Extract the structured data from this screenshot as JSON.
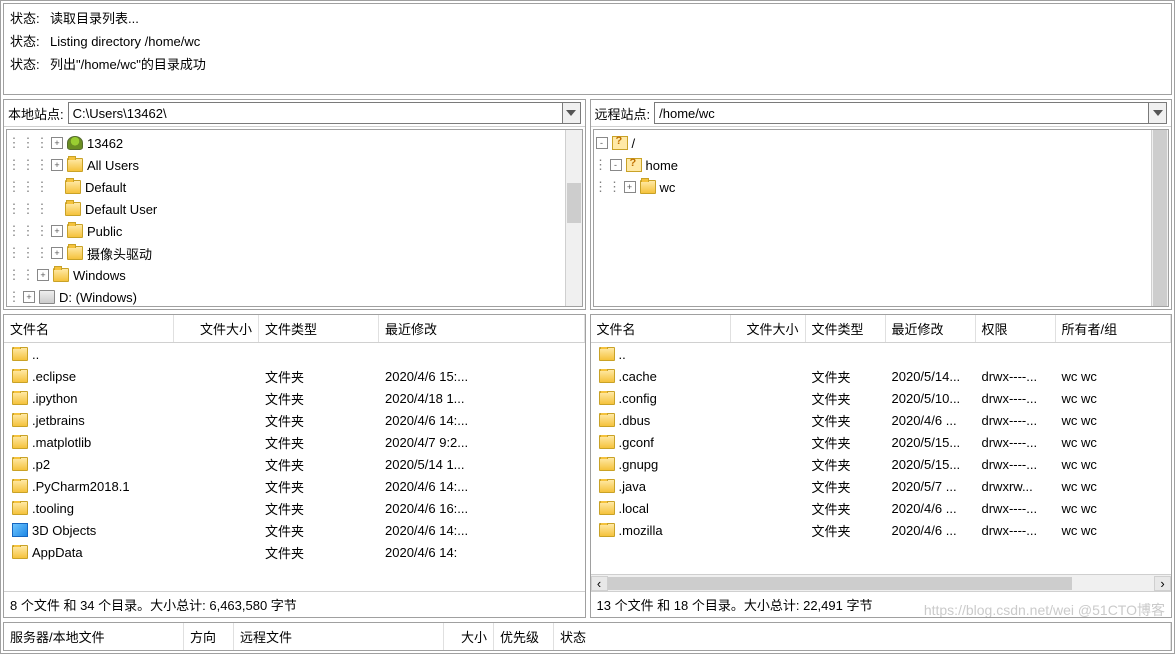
{
  "log": {
    "label": "状态:",
    "lines": [
      "读取目录列表...",
      "Listing directory /home/wc",
      "列出\"/home/wc\"的目录成功"
    ]
  },
  "local": {
    "site_label": "本地站点:",
    "path": "C:\\Users\\13462\\",
    "tree": [
      {
        "indent": 3,
        "exp": "+",
        "icon": "user",
        "label": "13462"
      },
      {
        "indent": 3,
        "exp": "+",
        "icon": "folder",
        "label": "All Users"
      },
      {
        "indent": 3,
        "exp": "",
        "icon": "folder",
        "label": "Default"
      },
      {
        "indent": 3,
        "exp": "",
        "icon": "folder",
        "label": "Default User"
      },
      {
        "indent": 3,
        "exp": "+",
        "icon": "folder",
        "label": "Public"
      },
      {
        "indent": 3,
        "exp": "+",
        "icon": "folder",
        "label": "摄像头驱动"
      },
      {
        "indent": 2,
        "exp": "+",
        "icon": "folder",
        "label": "Windows"
      },
      {
        "indent": 1,
        "exp": "+",
        "icon": "drive",
        "label": "D: (Windows)"
      }
    ],
    "columns": [
      "文件名",
      "文件大小",
      "文件类型",
      "最近修改"
    ],
    "files": [
      {
        "icon": "folder",
        "name": "..",
        "size": "",
        "type": "",
        "date": ""
      },
      {
        "icon": "folder",
        "name": ".eclipse",
        "size": "",
        "type": "文件夹",
        "date": "2020/4/6 15:..."
      },
      {
        "icon": "folder",
        "name": ".ipython",
        "size": "",
        "type": "文件夹",
        "date": "2020/4/18 1..."
      },
      {
        "icon": "folder",
        "name": ".jetbrains",
        "size": "",
        "type": "文件夹",
        "date": "2020/4/6 14:..."
      },
      {
        "icon": "folder",
        "name": ".matplotlib",
        "size": "",
        "type": "文件夹",
        "date": "2020/4/7 9:2..."
      },
      {
        "icon": "folder",
        "name": ".p2",
        "size": "",
        "type": "文件夹",
        "date": "2020/5/14 1..."
      },
      {
        "icon": "folder",
        "name": ".PyCharm2018.1",
        "size": "",
        "type": "文件夹",
        "date": "2020/4/6 14:..."
      },
      {
        "icon": "folder",
        "name": ".tooling",
        "size": "",
        "type": "文件夹",
        "date": "2020/4/6 16:..."
      },
      {
        "icon": "cube",
        "name": "3D Objects",
        "size": "",
        "type": "文件夹",
        "date": "2020/4/6 14:..."
      },
      {
        "icon": "folder",
        "name": "AppData",
        "size": "",
        "type": "文件夹",
        "date": "2020/4/6 14:"
      }
    ],
    "summary": "8 个文件 和 34 个目录。大小总计: 6,463,580 字节"
  },
  "remote": {
    "site_label": "远程站点:",
    "path": "/home/wc",
    "tree": [
      {
        "indent": 0,
        "exp": "-",
        "icon": "q",
        "label": "/"
      },
      {
        "indent": 1,
        "exp": "-",
        "icon": "q",
        "label": "home"
      },
      {
        "indent": 2,
        "exp": "+",
        "icon": "folder",
        "label": "wc"
      }
    ],
    "columns": [
      "文件名",
      "文件大小",
      "文件类型",
      "最近修改",
      "权限",
      "所有者/组"
    ],
    "files": [
      {
        "icon": "folder",
        "name": "..",
        "size": "",
        "type": "",
        "date": "",
        "perm": "",
        "own": ""
      },
      {
        "icon": "folder",
        "name": ".cache",
        "size": "",
        "type": "文件夹",
        "date": "2020/5/14...",
        "perm": "drwx----...",
        "own": "wc wc"
      },
      {
        "icon": "folder",
        "name": ".config",
        "size": "",
        "type": "文件夹",
        "date": "2020/5/10...",
        "perm": "drwx----...",
        "own": "wc wc"
      },
      {
        "icon": "folder",
        "name": ".dbus",
        "size": "",
        "type": "文件夹",
        "date": "2020/4/6 ...",
        "perm": "drwx----...",
        "own": "wc wc"
      },
      {
        "icon": "folder",
        "name": ".gconf",
        "size": "",
        "type": "文件夹",
        "date": "2020/5/15...",
        "perm": "drwx----...",
        "own": "wc wc"
      },
      {
        "icon": "folder",
        "name": ".gnupg",
        "size": "",
        "type": "文件夹",
        "date": "2020/5/15...",
        "perm": "drwx----...",
        "own": "wc wc"
      },
      {
        "icon": "folder",
        "name": ".java",
        "size": "",
        "type": "文件夹",
        "date": "2020/5/7 ...",
        "perm": "drwxrw...",
        "own": "wc wc"
      },
      {
        "icon": "folder",
        "name": ".local",
        "size": "",
        "type": "文件夹",
        "date": "2020/4/6 ...",
        "perm": "drwx----...",
        "own": "wc wc"
      },
      {
        "icon": "folder",
        "name": ".mozilla",
        "size": "",
        "type": "文件夹",
        "date": "2020/4/6 ...",
        "perm": "drwx----...",
        "own": "wc wc"
      }
    ],
    "summary": "13 个文件 和 18 个目录。大小总计: 22,491 字节"
  },
  "queue": {
    "columns": [
      "服务器/本地文件",
      "方向",
      "远程文件",
      "大小",
      "优先级",
      "状态"
    ]
  },
  "watermark": "https://blog.csdn.net/wei   @51CTO博客"
}
